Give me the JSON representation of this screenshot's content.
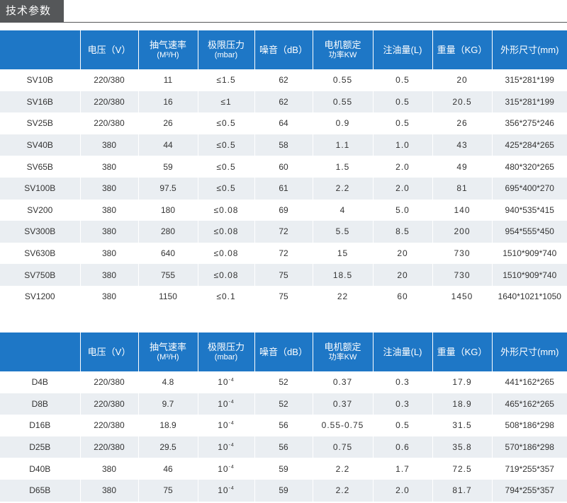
{
  "section_title": "技术参数",
  "headers": [
    {
      "l1": "",
      "l2": ""
    },
    {
      "l1": "电压（V）",
      "l2": ""
    },
    {
      "l1": "抽气速率",
      "l2": "(M³/H)"
    },
    {
      "l1": "极限压力",
      "l2": "(mbar)"
    },
    {
      "l1": "噪音（dB）",
      "l2": ""
    },
    {
      "l1": "电机额定",
      "l2": "功率KW"
    },
    {
      "l1": "注油量(L)",
      "l2": ""
    },
    {
      "l1": "重量（KG）",
      "l2": ""
    },
    {
      "l1": "外形尺寸(mm)",
      "l2": ""
    }
  ],
  "table1_rows": [
    [
      "SV10B",
      "220/380",
      "11",
      "≤1.5",
      "62",
      "0.55",
      "0.5",
      "20",
      "315*281*199"
    ],
    [
      "SV16B",
      "220/380",
      "16",
      "≤1",
      "62",
      "0.55",
      "0.5",
      "20.5",
      "315*281*199"
    ],
    [
      "SV25B",
      "220/380",
      "26",
      "≤0.5",
      "64",
      "0.9",
      "0.5",
      "26",
      "356*275*246"
    ],
    [
      "SV40B",
      "380",
      "44",
      "≤0.5",
      "58",
      "1.1",
      "1.0",
      "43",
      "425*284*265"
    ],
    [
      "SV65B",
      "380",
      "59",
      "≤0.5",
      "60",
      "1.5",
      "2.0",
      "49",
      "480*320*265"
    ],
    [
      "SV100B",
      "380",
      "97.5",
      "≤0.5",
      "61",
      "2.2",
      "2.0",
      "81",
      "695*400*270"
    ],
    [
      "SV200",
      "380",
      "180",
      "≤0.08",
      "69",
      "4",
      "5.0",
      "140",
      "940*535*415"
    ],
    [
      "SV300B",
      "380",
      "280",
      "≤0.08",
      "72",
      "5.5",
      "8.5",
      "200",
      "954*555*450"
    ],
    [
      "SV630B",
      "380",
      "640",
      "≤0.08",
      "72",
      "15",
      "20",
      "730",
      "1510*909*740"
    ],
    [
      "SV750B",
      "380",
      "755",
      "≤0.08",
      "75",
      "18.5",
      "20",
      "730",
      "1510*909*740"
    ],
    [
      "SV1200",
      "380",
      "1150",
      "≤0.1",
      "75",
      "22",
      "60",
      "1450",
      "1640*1021*1050"
    ]
  ],
  "table2_rows": [
    [
      "D4B",
      "220/380",
      "4.8",
      "10",
      "52",
      "0.37",
      "0.3",
      "17.9",
      "441*162*265"
    ],
    [
      "D8B",
      "220/380",
      "9.7",
      "10",
      "52",
      "0.37",
      "0.3",
      "18.9",
      "465*162*265"
    ],
    [
      "D16B",
      "220/380",
      "18.9",
      "10",
      "56",
      "0.55-0.75",
      "0.5",
      "31.5",
      "508*186*298"
    ],
    [
      "D25B",
      "220/380",
      "29.5",
      "10",
      "56",
      "0.75",
      "0.6",
      "35.8",
      "570*186*298"
    ],
    [
      "D40B",
      "380",
      "46",
      "10",
      "59",
      "2.2",
      "1.7",
      "72.5",
      "719*255*357"
    ],
    [
      "D65B",
      "380",
      "75",
      "10",
      "59",
      "2.2",
      "2.0",
      "81.7",
      "794*255*357"
    ]
  ],
  "table2_pressure_exponent": "-4",
  "colors": {
    "header_bg": "#1e77c6",
    "tab_bg": "#555759",
    "stripe": "#eaeef2"
  }
}
